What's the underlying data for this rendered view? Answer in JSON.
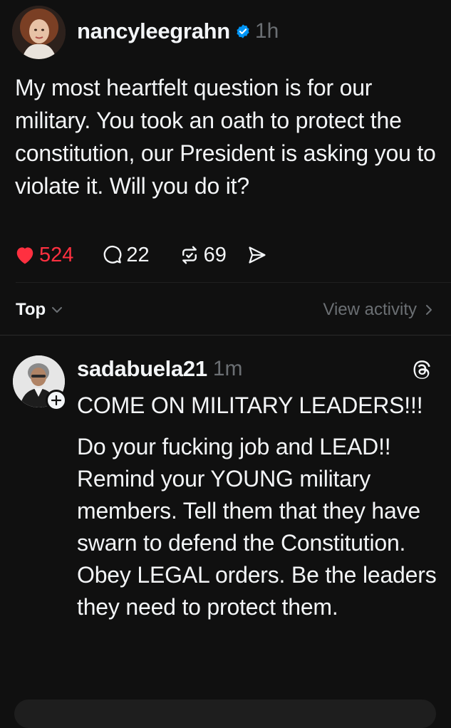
{
  "post": {
    "username": "nancyleegrahn",
    "time": "1h",
    "text": "My most heartfelt question is for our military. You took an oath to protect the constitution, our President is asking you to violate it. Will you do it?",
    "likes": "524",
    "replies": "22",
    "reposts": "69",
    "icons": {
      "verified": "verified-badge-icon",
      "like": "heart-icon",
      "reply": "comment-icon",
      "repost": "repost-icon",
      "share": "send-icon"
    }
  },
  "sort_bar": {
    "sort_label": "Top",
    "view_activity": "View activity"
  },
  "reply": {
    "username": "sadabuela21",
    "time": "1m",
    "paragraphs": [
      "COME ON MILITARY LEADERS!!!",
      "Do your fucking job and LEAD!! Remind your YOUNG military members. Tell them that they have swarn to defend the Constitution. Obey LEGAL orders. Be the leaders they need to protect them."
    ]
  },
  "colors": {
    "background": "#101010",
    "text": "#f3f5f7",
    "muted": "#6b6f73",
    "like": "#ff3040",
    "verified": "#0095f6"
  }
}
